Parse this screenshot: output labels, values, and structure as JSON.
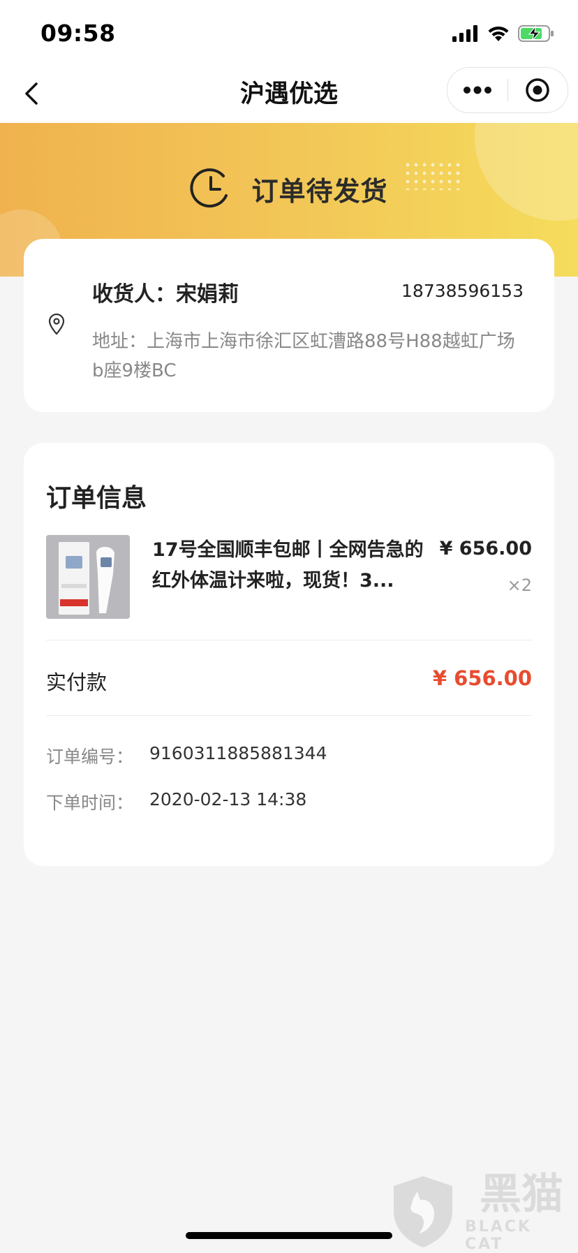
{
  "status_bar": {
    "time": "09:58"
  },
  "nav": {
    "title": "沪遇优选"
  },
  "banner": {
    "status_text": "订单待发货"
  },
  "address": {
    "recipient": "收货人：宋娟莉",
    "phone": "18738596153",
    "address": "地址：上海市上海市徐汇区虹漕路88号H88越虹广场b座9楼BC"
  },
  "order": {
    "title": "订单信息",
    "product": {
      "name": "17号全国顺丰包邮丨全网告急的红外体温计来啦，现货！3...",
      "price": "¥ 656.00",
      "quantity": "×2"
    },
    "paid_label": "实付款",
    "paid_value": "¥ 656.00",
    "order_no_label": "订单编号：",
    "order_no": "9160311885881344",
    "order_time_label": "下单时间：",
    "order_time": "2020-02-13 14:38"
  },
  "watermark": {
    "cn": "黑猫",
    "en": "BLACK CAT"
  },
  "colors": {
    "accent_price": "#e74c2f",
    "banner_start": "#f0b24e",
    "banner_end": "#f5dc5c"
  }
}
